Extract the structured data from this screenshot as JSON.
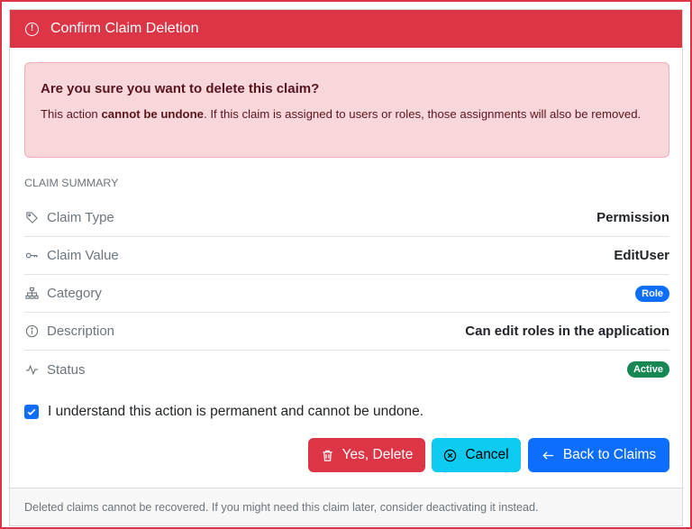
{
  "header": {
    "title": "Confirm Claim Deletion",
    "icon": "exclamation-circle-icon",
    "color": "#dc3545"
  },
  "alert": {
    "title": "Are you sure you want to delete this claim?",
    "text_before": "This action ",
    "text_bold": "cannot be undone",
    "text_after": ". If this claim is assigned to users or roles, those assignments will also be removed."
  },
  "summary": {
    "label": "CLAIM SUMMARY",
    "rows": [
      {
        "label": "Claim Type",
        "value": "Permission",
        "icon": "tag-icon"
      },
      {
        "label": "Claim Value",
        "value": "EditUser",
        "icon": "key-icon"
      },
      {
        "label": "Category",
        "value": "Role",
        "icon": "diagram-icon",
        "badge_color": "#0d6efd"
      },
      {
        "label": "Description",
        "value": "Can edit roles in the application",
        "icon": "info-circle-icon"
      },
      {
        "label": "Status",
        "value": "Active",
        "icon": "activity-icon",
        "badge_color": "#198754"
      }
    ]
  },
  "confirm": {
    "label": "I understand this action is permanent and cannot be undone.",
    "checked": true
  },
  "buttons": {
    "delete": "Yes, Delete",
    "cancel": "Cancel",
    "back": "Back to Claims"
  },
  "footer": {
    "text": "Deleted claims cannot be recovered. If you might need this claim later, consider deactivating it instead."
  }
}
